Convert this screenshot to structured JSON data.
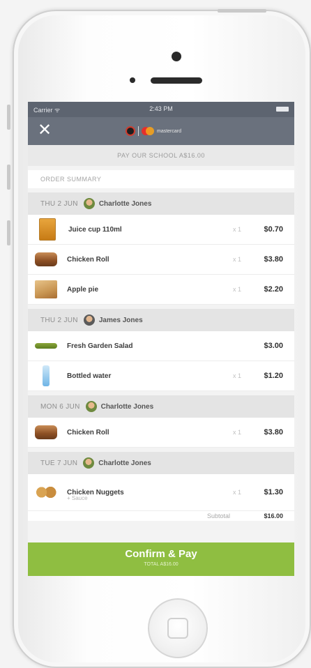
{
  "status_bar": {
    "carrier": "Carrier ᯤ",
    "time": "2:43 PM"
  },
  "nav": {
    "close_icon": "close-icon",
    "brand_text": "mastercard"
  },
  "pay_bar": "PAY OUR SCHOOL  A$16.00",
  "order_summary_label": "ORDER SUMMARY",
  "days": [
    {
      "date": "THU 2 JUN",
      "name": "Charlotte  Jones",
      "items": [
        {
          "name": "Juice cup 110ml",
          "qty": "x 1",
          "price": "$0.70",
          "icon": "juice-icon"
        },
        {
          "name": "Chicken Roll",
          "qty": "x 1",
          "price": "$3.80",
          "icon": "roll-icon"
        },
        {
          "name": "Apple pie",
          "qty": "x 1",
          "price": "$2.20",
          "icon": "pie-icon"
        }
      ]
    },
    {
      "date": "THU 2 JUN",
      "name": "James Jones",
      "items": [
        {
          "name": "Fresh Garden Salad",
          "qty": "",
          "price": "$3.00",
          "icon": "salad-icon"
        },
        {
          "name": "Bottled water",
          "qty": "x 1",
          "price": "$1.20",
          "icon": "water-icon"
        }
      ]
    },
    {
      "date": "MON 6 JUN",
      "name": "Charlotte  Jones",
      "items": [
        {
          "name": "Chicken Roll",
          "qty": "x 1",
          "price": "$3.80",
          "icon": "roll-icon"
        }
      ]
    },
    {
      "date": "TUE 7 JUN",
      "name": "Charlotte  Jones",
      "items": [
        {
          "name": "Chicken Nuggets",
          "sub": "+ Sauce",
          "qty": "x 1",
          "price": "$1.30",
          "icon": "nuggets-icon"
        }
      ]
    }
  ],
  "subtotal": {
    "label": "Subtotal",
    "value": "$16.00"
  },
  "confirm": {
    "label": "Confirm & Pay",
    "total": "TOTAL A$16.00"
  },
  "colors": {
    "nav": "#6a717d",
    "confirm": "#8fbe41"
  }
}
